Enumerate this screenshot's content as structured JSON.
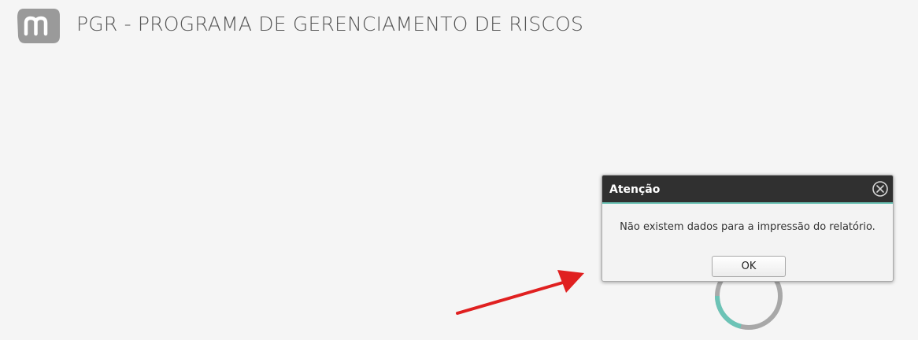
{
  "header": {
    "logo_icon": "app-logo-m-icon",
    "title": "PGR - PROGRAMA DE GERENCIAMENTO DE RISCOS"
  },
  "dialog": {
    "title": "Atenção",
    "close_icon": "close-circle-icon",
    "message": "Não existem dados para a impressão do relatório.",
    "ok_label": "OK"
  },
  "loading": {
    "icon": "loading-spinner-icon"
  },
  "annotation": {
    "icon": "red-arrow-icon"
  },
  "colors": {
    "background": "#f5f5f5",
    "header_text": "#555555",
    "dialog_header": "#303030",
    "accent": "#6cc3b6",
    "arrow": "#e02020",
    "spinner_track": "#a8a8a8"
  }
}
